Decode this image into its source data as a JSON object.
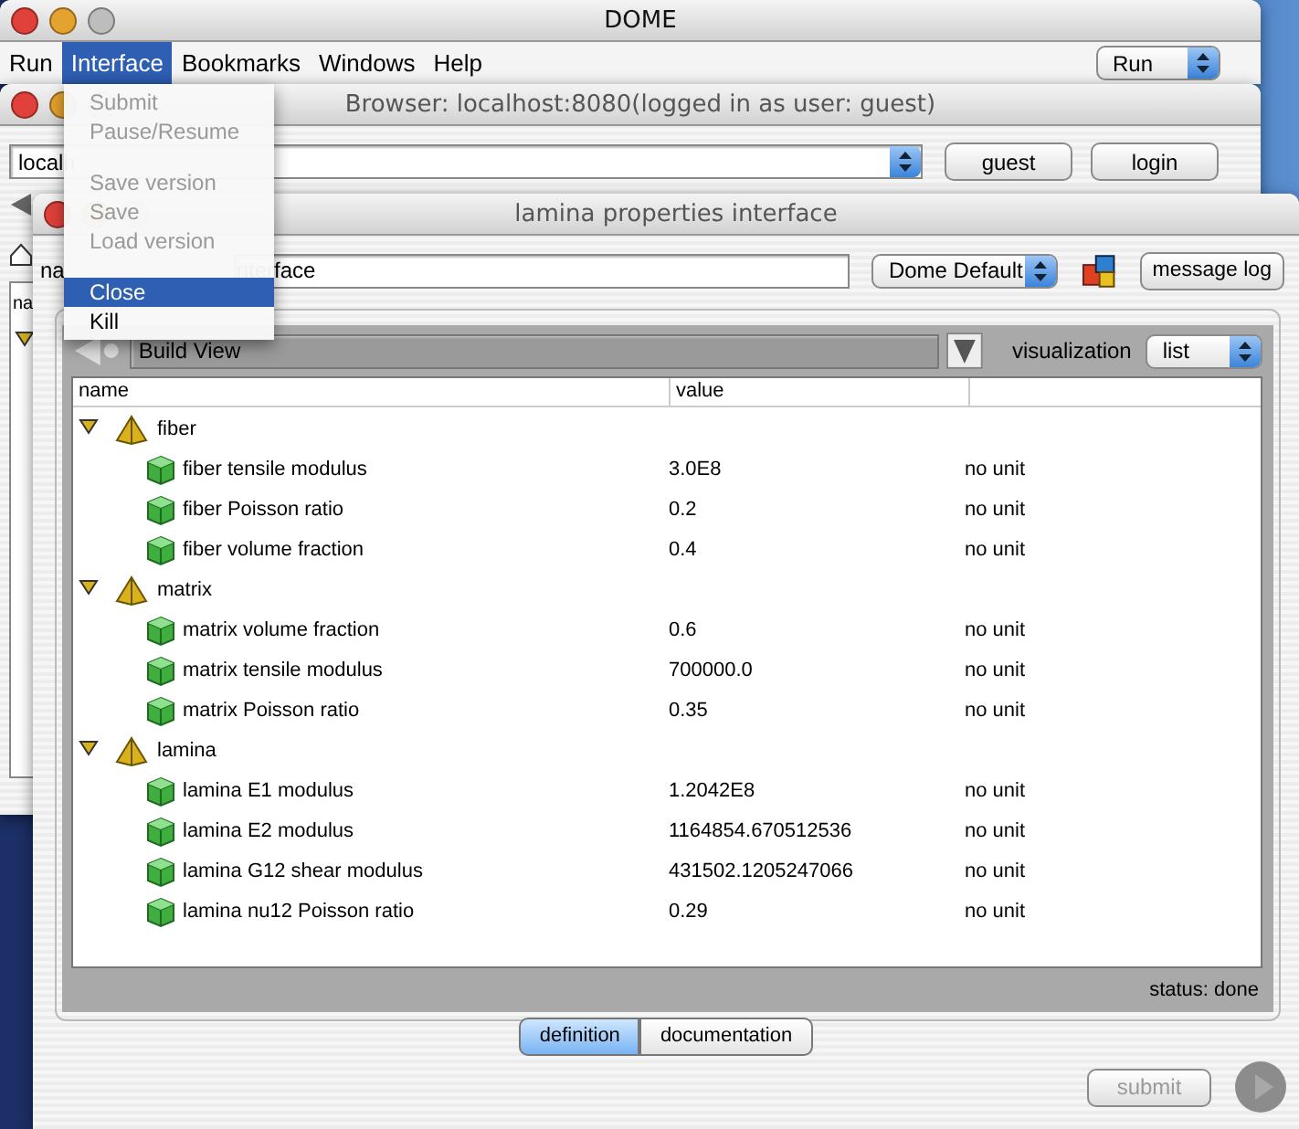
{
  "main_window": {
    "title": "DOME",
    "menus": [
      {
        "label": "Run",
        "selected": false
      },
      {
        "label": "Interface",
        "selected": true
      },
      {
        "label": "Bookmarks",
        "selected": false
      },
      {
        "label": "Windows",
        "selected": false
      },
      {
        "label": "Help",
        "selected": false
      }
    ],
    "mode_select": "Run"
  },
  "open_menu": {
    "items": [
      {
        "kind": "item",
        "label": "Submit",
        "disabled": true,
        "selected": false
      },
      {
        "kind": "item",
        "label": "Pause/Resume",
        "disabled": true,
        "selected": false
      },
      {
        "kind": "separator"
      },
      {
        "kind": "item",
        "label": "Save version",
        "disabled": true,
        "selected": false
      },
      {
        "kind": "item",
        "label": "Save",
        "disabled": true,
        "selected": false
      },
      {
        "kind": "item",
        "label": "Load version",
        "disabled": true,
        "selected": false
      },
      {
        "kind": "separator"
      },
      {
        "kind": "item",
        "label": "Close",
        "disabled": false,
        "selected": true
      },
      {
        "kind": "item",
        "label": "Kill",
        "disabled": false,
        "selected": false
      }
    ]
  },
  "browser_window": {
    "title": "Browser: localhost:8080(logged in as user: guest)",
    "address": "localh",
    "user_button": "guest",
    "login_button": "login",
    "side_header": "na"
  },
  "interface_window": {
    "title": "lamina properties interface",
    "name_label": "na",
    "name_value": "nterface",
    "view_select": "Dome Default",
    "message_log_button": "message log",
    "view_field": "Build View",
    "visualization_label": "visualization",
    "visualization_select": "list",
    "table": {
      "columns": [
        "name",
        "value"
      ],
      "groups": [
        {
          "name": "fiber",
          "expanded": true,
          "children": [
            {
              "name": "fiber tensile modulus",
              "value": "3.0E8",
              "unit": "no unit"
            },
            {
              "name": "fiber Poisson ratio",
              "value": "0.2",
              "unit": "no unit"
            },
            {
              "name": "fiber volume fraction",
              "value": "0.4",
              "unit": "no unit"
            }
          ]
        },
        {
          "name": "matrix",
          "expanded": true,
          "children": [
            {
              "name": "matrix volume fraction",
              "value": "0.6",
              "unit": "no unit"
            },
            {
              "name": "matrix tensile modulus",
              "value": "700000.0",
              "unit": "no unit"
            },
            {
              "name": "matrix Poisson ratio",
              "value": "0.35",
              "unit": "no unit"
            }
          ]
        },
        {
          "name": "lamina",
          "expanded": true,
          "children": [
            {
              "name": "lamina E1 modulus",
              "value": "1.2042E8",
              "unit": "no unit"
            },
            {
              "name": "lamina E2 modulus",
              "value": "1164854.670512536",
              "unit": "no unit"
            },
            {
              "name": "lamina G12 shear modulus",
              "value": "431502.1205247066",
              "unit": "no unit"
            },
            {
              "name": "lamina nu12 Poisson ratio",
              "value": "0.29",
              "unit": "no unit"
            }
          ]
        }
      ]
    },
    "status": "status: done",
    "tabs": [
      {
        "label": "definition",
        "selected": true
      },
      {
        "label": "documentation",
        "selected": false
      }
    ],
    "submit_button": {
      "label": "submit",
      "disabled": true
    }
  }
}
